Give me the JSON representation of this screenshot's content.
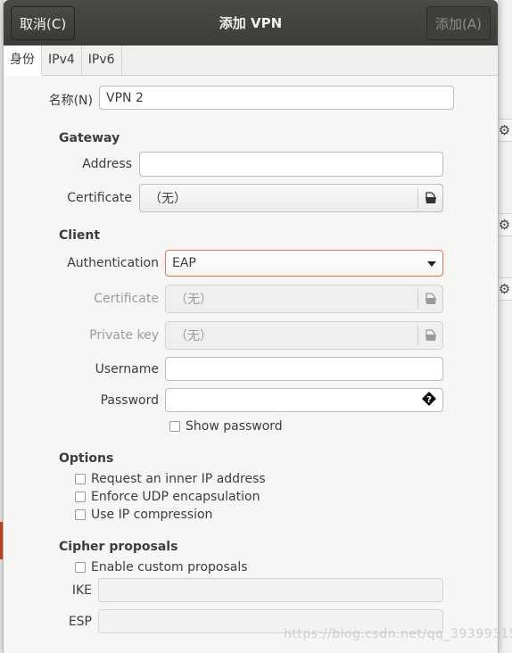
{
  "dialog": {
    "title": "添加 VPN",
    "cancel_label": "取消(C)",
    "add_label": "添加(A)"
  },
  "tabs": [
    {
      "label": "身份"
    },
    {
      "label": "IPv4"
    },
    {
      "label": "IPv6"
    }
  ],
  "name_label": "名称(N)",
  "name_value": "VPN 2",
  "gateway": {
    "heading": "Gateway",
    "address_label": "Address",
    "address_value": "",
    "certificate_label": "Certificate",
    "certificate_value": "（无）"
  },
  "client": {
    "heading": "Client",
    "authentication_label": "Authentication",
    "authentication_value": "EAP",
    "certificate_label": "Certificate",
    "certificate_value": "（无）",
    "private_key_label": "Private key",
    "private_key_value": "（无）",
    "username_label": "Username",
    "username_value": "",
    "password_label": "Password",
    "password_value": "",
    "show_password_label": "Show password"
  },
  "options": {
    "heading": "Options",
    "items": [
      {
        "label": "Request an inner IP address",
        "checked": false
      },
      {
        "label": "Enforce UDP encapsulation",
        "checked": false
      },
      {
        "label": "Use IP compression",
        "checked": false
      }
    ]
  },
  "cipher": {
    "heading": "Cipher proposals",
    "enable_label": "Enable custom proposals",
    "ike_label": "IKE",
    "ike_value": "",
    "esp_label": "ESP",
    "esp_value": ""
  },
  "watermark": "https://blog.csdn.net/qq_39399315",
  "icons": {
    "file_chooser": "document-open-icon",
    "password_peek": "question-icon",
    "dropdown": "triangle-down-icon",
    "background_gear": "gear-icon"
  },
  "colors": {
    "titlebar": "#3d3c39",
    "focus_border": "#e3754f"
  }
}
